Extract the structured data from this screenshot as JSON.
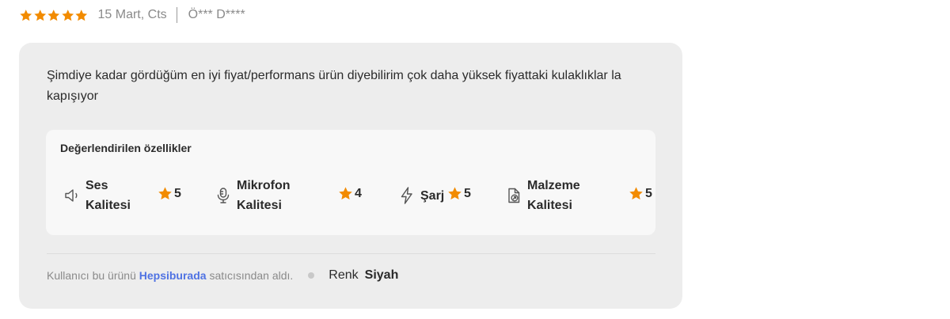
{
  "review": {
    "rating": 5,
    "max_rating": 5,
    "date": "15 Mart, Cts",
    "author": "Ö*** D****",
    "comment": "Şimdiye kadar gördüğüm en iyi fiyat/performans ürün diyebilirim çok daha yüksek fiyattaki kulaklıklar la kapışıyor",
    "colors": {
      "star": "#f28b00",
      "card_bg": "#ededed",
      "features_bg": "#f8f8f8",
      "link": "#4f72e3"
    }
  },
  "features": {
    "title": "Değerlendirilen özellikler",
    "items": [
      {
        "line1": "Ses",
        "line2": "Kalitesi",
        "score": "5",
        "icon": "speaker-icon"
      },
      {
        "line1": "Mikrofon",
        "line2": "Kalitesi",
        "score": "4",
        "icon": "microphone-icon"
      },
      {
        "line1": "Şarj",
        "line2": "",
        "score": "5",
        "icon": "lightning-icon"
      },
      {
        "line1": "Malzeme",
        "line2": "Kalitesi",
        "score": "5",
        "icon": "material-quality-icon"
      }
    ]
  },
  "footer": {
    "buyer_prefix": "Kullanıcı bu ürünü",
    "seller": "Hepsiburada",
    "buyer_suffix": "satıcısından aldı.",
    "attribute_name": "Renk",
    "attribute_value": "Siyah"
  }
}
